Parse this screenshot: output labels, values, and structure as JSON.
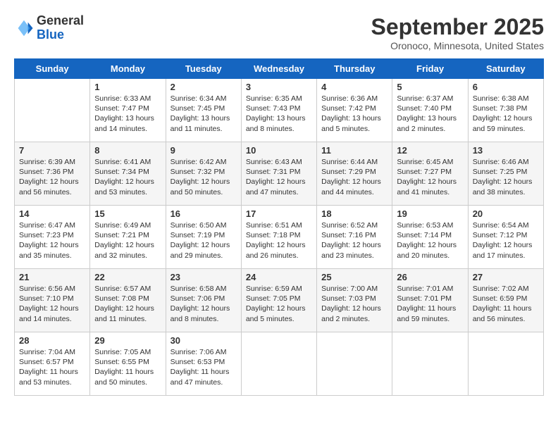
{
  "header": {
    "logo_general": "General",
    "logo_blue": "Blue",
    "month": "September 2025",
    "location": "Oronoco, Minnesota, United States"
  },
  "days_of_week": [
    "Sunday",
    "Monday",
    "Tuesday",
    "Wednesday",
    "Thursday",
    "Friday",
    "Saturday"
  ],
  "weeks": [
    [
      {
        "num": "",
        "info": ""
      },
      {
        "num": "1",
        "info": "Sunrise: 6:33 AM\nSunset: 7:47 PM\nDaylight: 13 hours\nand 14 minutes."
      },
      {
        "num": "2",
        "info": "Sunrise: 6:34 AM\nSunset: 7:45 PM\nDaylight: 13 hours\nand 11 minutes."
      },
      {
        "num": "3",
        "info": "Sunrise: 6:35 AM\nSunset: 7:43 PM\nDaylight: 13 hours\nand 8 minutes."
      },
      {
        "num": "4",
        "info": "Sunrise: 6:36 AM\nSunset: 7:42 PM\nDaylight: 13 hours\nand 5 minutes."
      },
      {
        "num": "5",
        "info": "Sunrise: 6:37 AM\nSunset: 7:40 PM\nDaylight: 13 hours\nand 2 minutes."
      },
      {
        "num": "6",
        "info": "Sunrise: 6:38 AM\nSunset: 7:38 PM\nDaylight: 12 hours\nand 59 minutes."
      }
    ],
    [
      {
        "num": "7",
        "info": "Sunrise: 6:39 AM\nSunset: 7:36 PM\nDaylight: 12 hours\nand 56 minutes."
      },
      {
        "num": "8",
        "info": "Sunrise: 6:41 AM\nSunset: 7:34 PM\nDaylight: 12 hours\nand 53 minutes."
      },
      {
        "num": "9",
        "info": "Sunrise: 6:42 AM\nSunset: 7:32 PM\nDaylight: 12 hours\nand 50 minutes."
      },
      {
        "num": "10",
        "info": "Sunrise: 6:43 AM\nSunset: 7:31 PM\nDaylight: 12 hours\nand 47 minutes."
      },
      {
        "num": "11",
        "info": "Sunrise: 6:44 AM\nSunset: 7:29 PM\nDaylight: 12 hours\nand 44 minutes."
      },
      {
        "num": "12",
        "info": "Sunrise: 6:45 AM\nSunset: 7:27 PM\nDaylight: 12 hours\nand 41 minutes."
      },
      {
        "num": "13",
        "info": "Sunrise: 6:46 AM\nSunset: 7:25 PM\nDaylight: 12 hours\nand 38 minutes."
      }
    ],
    [
      {
        "num": "14",
        "info": "Sunrise: 6:47 AM\nSunset: 7:23 PM\nDaylight: 12 hours\nand 35 minutes."
      },
      {
        "num": "15",
        "info": "Sunrise: 6:49 AM\nSunset: 7:21 PM\nDaylight: 12 hours\nand 32 minutes."
      },
      {
        "num": "16",
        "info": "Sunrise: 6:50 AM\nSunset: 7:19 PM\nDaylight: 12 hours\nand 29 minutes."
      },
      {
        "num": "17",
        "info": "Sunrise: 6:51 AM\nSunset: 7:18 PM\nDaylight: 12 hours\nand 26 minutes."
      },
      {
        "num": "18",
        "info": "Sunrise: 6:52 AM\nSunset: 7:16 PM\nDaylight: 12 hours\nand 23 minutes."
      },
      {
        "num": "19",
        "info": "Sunrise: 6:53 AM\nSunset: 7:14 PM\nDaylight: 12 hours\nand 20 minutes."
      },
      {
        "num": "20",
        "info": "Sunrise: 6:54 AM\nSunset: 7:12 PM\nDaylight: 12 hours\nand 17 minutes."
      }
    ],
    [
      {
        "num": "21",
        "info": "Sunrise: 6:56 AM\nSunset: 7:10 PM\nDaylight: 12 hours\nand 14 minutes."
      },
      {
        "num": "22",
        "info": "Sunrise: 6:57 AM\nSunset: 7:08 PM\nDaylight: 12 hours\nand 11 minutes."
      },
      {
        "num": "23",
        "info": "Sunrise: 6:58 AM\nSunset: 7:06 PM\nDaylight: 12 hours\nand 8 minutes."
      },
      {
        "num": "24",
        "info": "Sunrise: 6:59 AM\nSunset: 7:05 PM\nDaylight: 12 hours\nand 5 minutes."
      },
      {
        "num": "25",
        "info": "Sunrise: 7:00 AM\nSunset: 7:03 PM\nDaylight: 12 hours\nand 2 minutes."
      },
      {
        "num": "26",
        "info": "Sunrise: 7:01 AM\nSunset: 7:01 PM\nDaylight: 11 hours\nand 59 minutes."
      },
      {
        "num": "27",
        "info": "Sunrise: 7:02 AM\nSunset: 6:59 PM\nDaylight: 11 hours\nand 56 minutes."
      }
    ],
    [
      {
        "num": "28",
        "info": "Sunrise: 7:04 AM\nSunset: 6:57 PM\nDaylight: 11 hours\nand 53 minutes."
      },
      {
        "num": "29",
        "info": "Sunrise: 7:05 AM\nSunset: 6:55 PM\nDaylight: 11 hours\nand 50 minutes."
      },
      {
        "num": "30",
        "info": "Sunrise: 7:06 AM\nSunset: 6:53 PM\nDaylight: 11 hours\nand 47 minutes."
      },
      {
        "num": "",
        "info": ""
      },
      {
        "num": "",
        "info": ""
      },
      {
        "num": "",
        "info": ""
      },
      {
        "num": "",
        "info": ""
      }
    ]
  ]
}
